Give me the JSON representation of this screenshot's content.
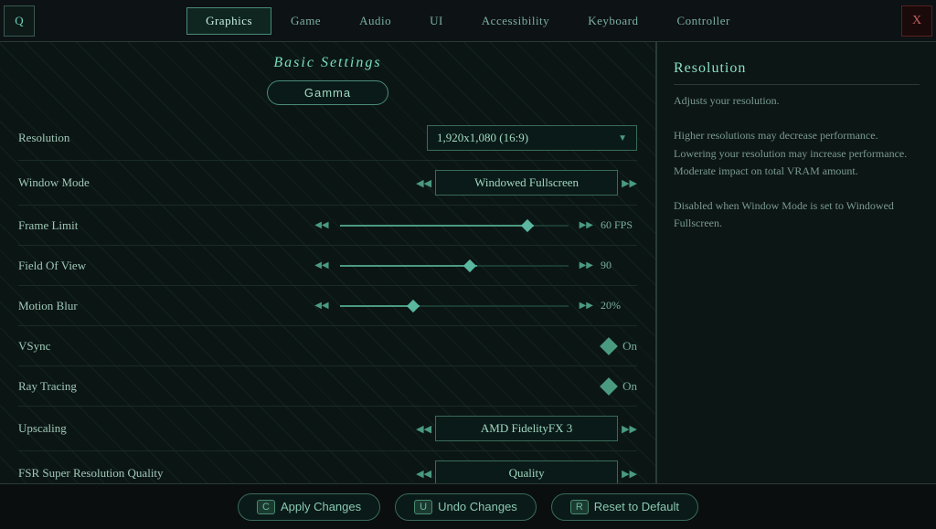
{
  "nav": {
    "left_icon": "Q",
    "right_icon": "X",
    "tabs": [
      {
        "label": "Graphics",
        "active": true
      },
      {
        "label": "Game",
        "active": false
      },
      {
        "label": "Audio",
        "active": false
      },
      {
        "label": "UI",
        "active": false
      },
      {
        "label": "Accessibility",
        "active": false
      },
      {
        "label": "Keyboard",
        "active": false
      },
      {
        "label": "Controller",
        "active": false
      }
    ]
  },
  "section": {
    "title": "Basic Settings"
  },
  "gamma_button": {
    "label": "Gamma"
  },
  "settings": [
    {
      "label": "Resolution",
      "type": "dropdown",
      "value": "1,920x1,080 (16:9)"
    },
    {
      "label": "Window Mode",
      "type": "arrow-selector",
      "value": "Windowed Fullscreen"
    },
    {
      "label": "Frame Limit",
      "type": "slider",
      "value": "60 FPS",
      "fill_pct": 85
    },
    {
      "label": "Field Of View",
      "type": "slider",
      "value": "90",
      "fill_pct": 60
    },
    {
      "label": "Motion Blur",
      "type": "slider",
      "value": "20%",
      "fill_pct": 35
    },
    {
      "label": "VSync",
      "type": "toggle",
      "value": "On"
    },
    {
      "label": "Ray Tracing",
      "type": "toggle",
      "value": "On"
    },
    {
      "label": "Upscaling",
      "type": "arrow-selector",
      "value": "AMD FidelityFX 3"
    },
    {
      "label": "FSR Super Resolution Quality",
      "type": "arrow-selector",
      "value": "Quality"
    }
  ],
  "sidebar": {
    "title": "Resolution",
    "text": "Adjusts your resolution.\n\nHigher resolutions may decrease performance. Lowering your resolution may increase performance. Moderate impact on total VRAM amount.\n\nDisabled when Window Mode is set to Windowed Fullscreen."
  },
  "bottom_bar": {
    "apply": {
      "key": "C",
      "label": "Apply Changes"
    },
    "undo": {
      "key": "U",
      "label": "Undo Changes"
    },
    "reset": {
      "key": "R",
      "label": "Reset to Default"
    }
  }
}
